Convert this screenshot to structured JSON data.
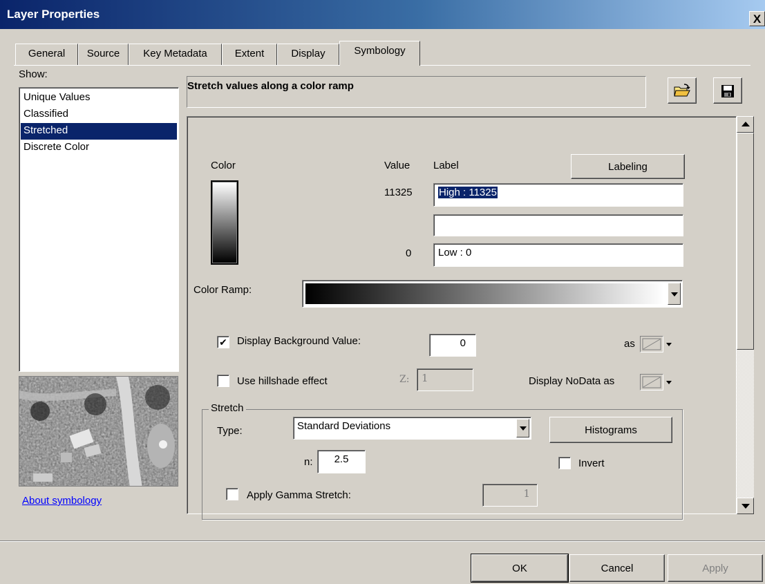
{
  "window": {
    "title": "Layer Properties",
    "close_label": "X"
  },
  "tabs": [
    {
      "label": "General"
    },
    {
      "label": "Source"
    },
    {
      "label": "Key Metadata"
    },
    {
      "label": "Extent"
    },
    {
      "label": "Display"
    },
    {
      "label": "Symbology"
    }
  ],
  "show": {
    "label": "Show:",
    "items": [
      {
        "label": "Unique Values",
        "selected": false
      },
      {
        "label": "Classified",
        "selected": false
      },
      {
        "label": "Stretched",
        "selected": true
      },
      {
        "label": "Discrete Color",
        "selected": false
      }
    ]
  },
  "about_link": "About symbology",
  "description": "Stretch values along a color ramp",
  "symbology": {
    "color_header": "Color",
    "value_header": "Value",
    "label_header": "Label",
    "labeling_button": "Labeling",
    "high_value": "11325",
    "high_label": "High : 11325",
    "mid_label": "",
    "low_value": "0",
    "low_label": "Low : 0",
    "color_ramp_label": "Color Ramp:",
    "display_background": {
      "label": "Display Background Value:",
      "checked": true,
      "value": "0",
      "as_label": "as"
    },
    "hillshade": {
      "label": "Use hillshade effect",
      "checked": false,
      "z_label": "Z:",
      "z_value": "1"
    },
    "nodata_label": "Display NoData as",
    "stretch": {
      "group_title": "Stretch",
      "type_label": "Type:",
      "type_value": "Standard Deviations",
      "histograms_button": "Histograms",
      "n_label": "n:",
      "n_value": "2.5",
      "invert_label": "Invert",
      "invert_checked": false,
      "gamma_label": "Apply Gamma Stretch:",
      "gamma_checked": false,
      "gamma_value": "1"
    }
  },
  "buttons": {
    "ok": "OK",
    "cancel": "Cancel",
    "apply": "Apply"
  },
  "colors": {
    "title_start": "#0a246a",
    "title_end": "#a6caf0",
    "selection": "#0a246a",
    "link": "#0000ff",
    "face": "#d4d0c8"
  }
}
